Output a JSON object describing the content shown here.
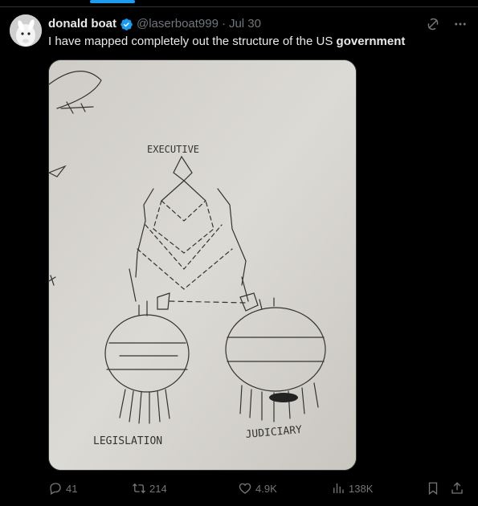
{
  "tweet": {
    "author_name": "donald boat",
    "handle": "@laserboat999",
    "separator": "·",
    "date": "Jul 30",
    "text_main": "I have mapped completely out the structure of the US ",
    "text_bold": "government"
  },
  "drawing": {
    "label_top": "EXECUTIVE",
    "label_left": "LEGISLATION",
    "label_right": "JUDICIARY"
  },
  "stats": {
    "replies": "41",
    "reposts": "214",
    "likes": "4.9K",
    "views": "138K"
  },
  "colors": {
    "accent": "#1d9bf0",
    "muted": "#71767b",
    "text": "#e7e9ea",
    "background": "#000000",
    "repost_green": "#00ba7c"
  },
  "icons": {
    "verified": "verified-badge-icon",
    "grok": "grok-icon",
    "more": "more-icon",
    "reply": "reply-icon",
    "repost": "repost-icon",
    "like": "like-icon",
    "views": "views-icon",
    "bookmark": "bookmark-icon",
    "share": "share-icon"
  }
}
